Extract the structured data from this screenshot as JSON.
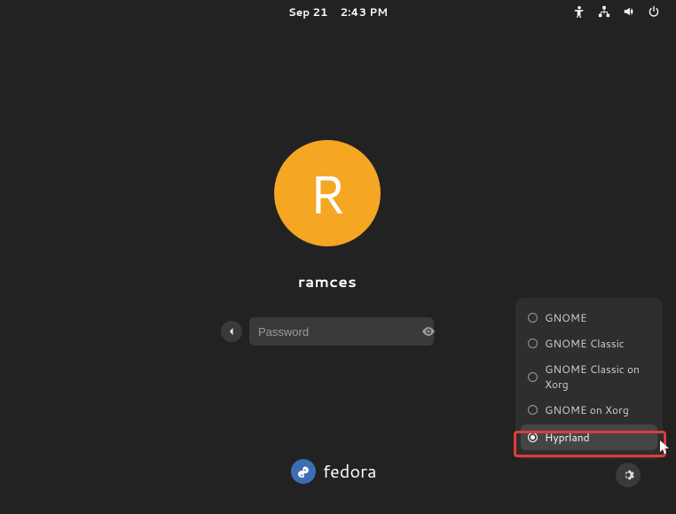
{
  "topbar": {
    "date": "Sep 21",
    "time": "2:43 PM"
  },
  "login": {
    "avatar_initial": "R",
    "username": "ramces",
    "password_placeholder": "Password"
  },
  "brand": {
    "name": "fedora"
  },
  "sessions": {
    "items": [
      {
        "label": "GNOME",
        "selected": false
      },
      {
        "label": "GNOME Classic",
        "selected": false
      },
      {
        "label": "GNOME Classic on Xorg",
        "selected": false
      },
      {
        "label": "GNOME on Xorg",
        "selected": false
      },
      {
        "label": "Hyprland",
        "selected": true
      }
    ]
  }
}
